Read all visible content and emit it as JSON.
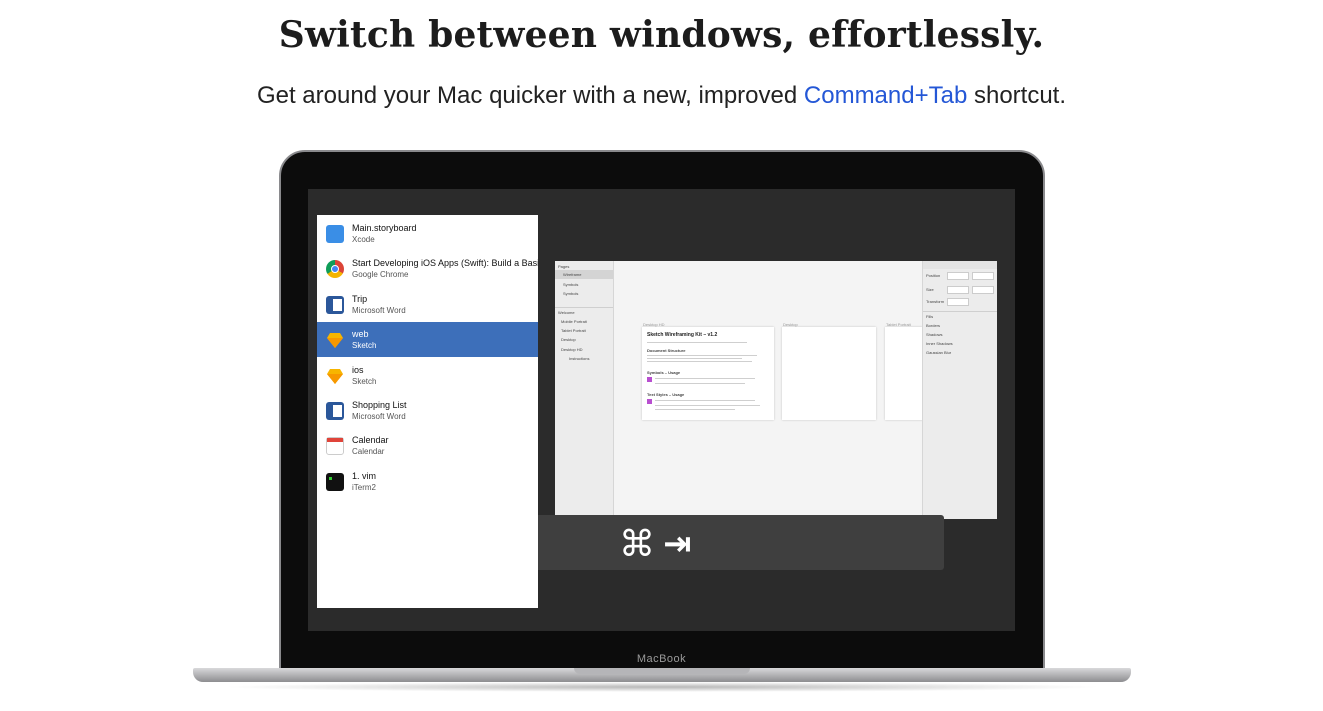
{
  "headline": "Switch between windows, effortlessly.",
  "subhead": {
    "before": "Get around your Mac quicker with a new, improved ",
    "link": "Command+Tab",
    "after": " shortcut."
  },
  "device_label": "MacBook",
  "switcher": {
    "items": [
      {
        "name": "Main.storyboard",
        "app": "Xcode",
        "icon": "xcode-icon",
        "color": "#3a8ee6"
      },
      {
        "name": "Start Developing iOS Apps (Swift): Build a Basic UI",
        "app": "Google Chrome",
        "icon": "chrome-icon",
        "color": "#db4437"
      },
      {
        "name": "Trip",
        "app": "Microsoft Word",
        "icon": "word-icon",
        "color": "#2b579a"
      },
      {
        "name": "web",
        "app": "Sketch",
        "icon": "sketch-icon",
        "color": "#f7b500",
        "selected": true
      },
      {
        "name": "ios",
        "app": "Sketch",
        "icon": "sketch-icon",
        "color": "#f7b500"
      },
      {
        "name": "Shopping List",
        "app": "Microsoft Word",
        "icon": "word-icon",
        "color": "#2b579a"
      },
      {
        "name": "Calendar",
        "app": "Calendar",
        "icon": "calendar-icon",
        "color": "#e0443a"
      },
      {
        "name": "1. vim",
        "app": "iTerm2",
        "icon": "iterm-icon",
        "color": "#111111"
      }
    ]
  },
  "preview": {
    "pages_label": "Pages",
    "pages": [
      "Wireframe",
      "Symbols",
      "Symbols"
    ],
    "layers_label": "Welcome",
    "layers": [
      "Mobile Portrait",
      "Tablet Portrait",
      "Desktop",
      "Desktop HD",
      "Instructions"
    ],
    "artboard_labels": [
      "Desktop HD",
      "Desktop",
      "Tablet Portrait"
    ],
    "doc_title": "Sketch Wireframing Kit – v1.2",
    "sections": [
      "Document Structure",
      "Symbols – Usage",
      "Text Styles – Usage"
    ],
    "inspector": [
      "Position",
      "Size",
      "Transform",
      "Fills",
      "Borders",
      "Shadows",
      "Inner Shadows",
      "Gaussian Blur"
    ]
  },
  "shortcut": {
    "cmd_symbol": "⌘",
    "tab_symbol": "⇥"
  }
}
